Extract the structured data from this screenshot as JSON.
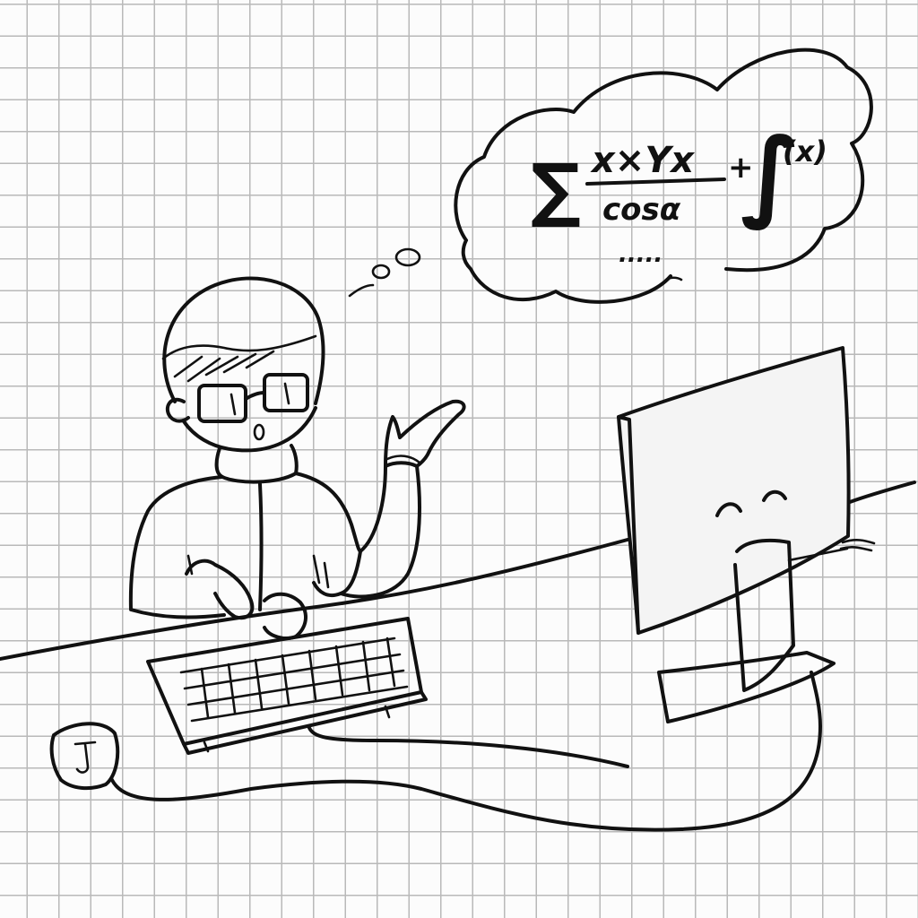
{
  "formula": {
    "sum_symbol": "∑",
    "numerator": "x×Yx",
    "denominator": "cosα",
    "plus": "+",
    "integral_symbol": "∫",
    "integrand": "(x)",
    "continuation": "....."
  },
  "colors": {
    "ink": "#111111",
    "grid": "#b9b9b9",
    "paper": "#fcfcfc"
  }
}
